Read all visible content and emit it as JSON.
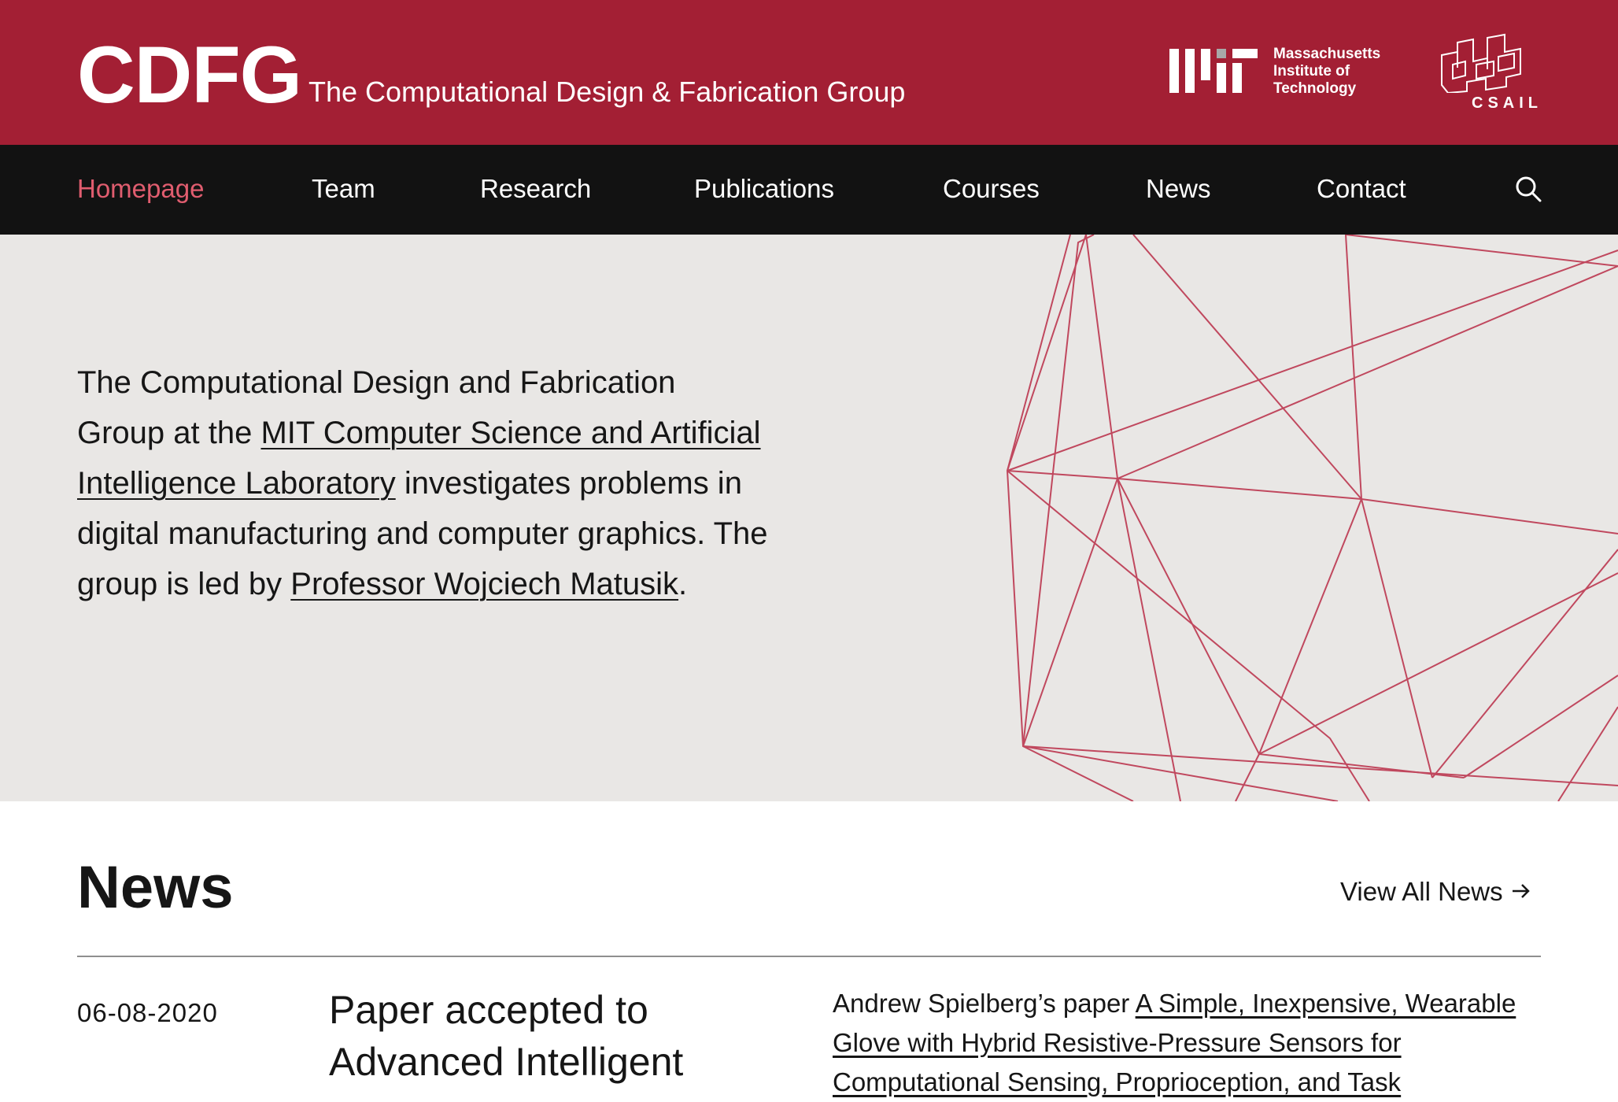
{
  "header": {
    "brand": "CDFG",
    "tagline": "The Computational Design & Fabrication Group",
    "mit_text": [
      "Massachusetts",
      "Institute of",
      "Technology"
    ],
    "csail_text": "CSAIL"
  },
  "nav": {
    "items": [
      {
        "label": "Homepage",
        "active": true
      },
      {
        "label": "Team"
      },
      {
        "label": "Research"
      },
      {
        "label": "Publications"
      },
      {
        "label": "Courses"
      },
      {
        "label": "News"
      },
      {
        "label": "Contact"
      }
    ],
    "search_icon": "search-icon"
  },
  "hero": {
    "text_1": "The Computational Design and Fabrication Group at the ",
    "link_1": "MIT Computer Science and Artificial Intelligence Laboratory",
    "text_2": " investigates problems in digital manufacturing and computer graphics. The group is led by ",
    "link_2": "Professor Wojciech Matusik",
    "text_3": "."
  },
  "news": {
    "title": "News",
    "view_all": "View All News",
    "items": [
      {
        "date": "06-08-2020",
        "headline": "Paper accepted to Advanced Intelligent",
        "body_prefix": "Andrew Spielberg’s paper ",
        "body_link": "A Simple, Inexpensive, Wearable Glove with Hybrid Resistive-Pressure Sensors for Computational Sensing, Proprioception, and Task"
      }
    ]
  },
  "colors": {
    "brand_red": "#a31f34",
    "nav_bg": "#121212",
    "nav_active": "#e05d6f",
    "hero_bg": "#e9e7e5",
    "mesh_line": "#c0485e"
  }
}
